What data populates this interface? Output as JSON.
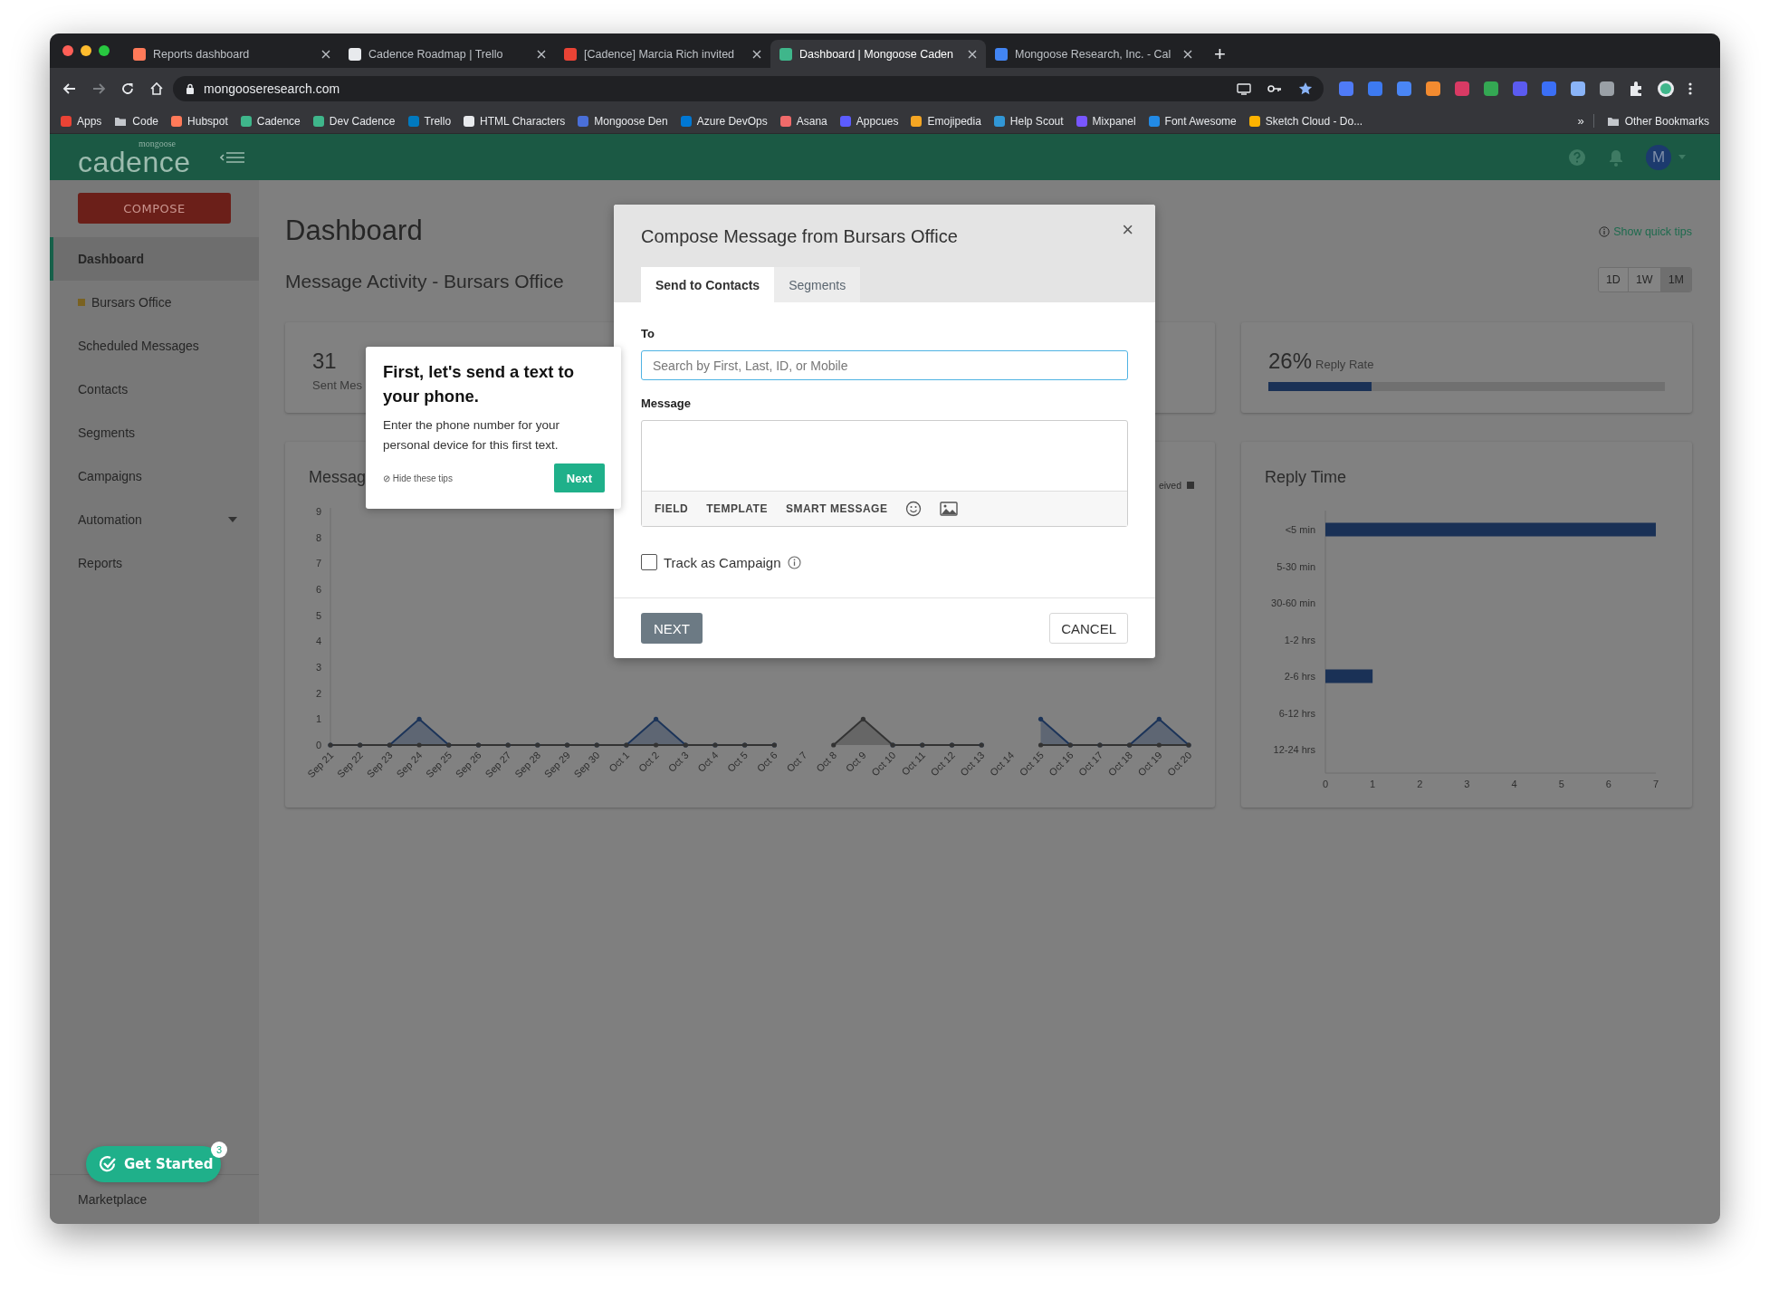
{
  "browser": {
    "tabs": [
      {
        "title": "Reports dashboard",
        "color": "#ff7a59",
        "selected": false
      },
      {
        "title": "Cadence Roadmap | Trello",
        "color": "#e8eaed",
        "selected": false
      },
      {
        "title": "[Cadence] Marcia Rich invited",
        "color": "#ea4335",
        "selected": false
      },
      {
        "title": "Dashboard | Mongoose Caden",
        "color": "#3fb68b",
        "selected": true
      },
      {
        "title": "Mongoose Research, Inc. - Cal",
        "color": "#4285f4",
        "selected": false
      }
    ],
    "new_tab": "+",
    "url": "mongooseresearch.com",
    "bookmarks": [
      {
        "label": "Apps",
        "kind": "site",
        "color": "#ea4335"
      },
      {
        "label": "Code",
        "kind": "folder",
        "color": "#c4c7cc"
      },
      {
        "label": "Hubspot",
        "kind": "site",
        "color": "#ff7a59"
      },
      {
        "label": "Cadence",
        "kind": "site",
        "color": "#3fb68b"
      },
      {
        "label": "Dev Cadence",
        "kind": "site",
        "color": "#3fb68b"
      },
      {
        "label": "Trello",
        "kind": "site",
        "color": "#0079bf"
      },
      {
        "label": "HTML Characters",
        "kind": "site",
        "color": "#e8eaed"
      },
      {
        "label": "Mongoose Den",
        "kind": "site",
        "color": "#4a6fd8"
      },
      {
        "label": "Azure DevOps",
        "kind": "site",
        "color": "#0078d4"
      },
      {
        "label": "Asana",
        "kind": "site",
        "color": "#f06a6a"
      },
      {
        "label": "Appcues",
        "kind": "site",
        "color": "#5c5cff"
      },
      {
        "label": "Emojipedia",
        "kind": "site",
        "color": "#f5a623"
      },
      {
        "label": "Help Scout",
        "kind": "site",
        "color": "#3197d6"
      },
      {
        "label": "Mixpanel",
        "kind": "site",
        "color": "#7856ff"
      },
      {
        "label": "Font Awesome",
        "kind": "site",
        "color": "#228ae6"
      },
      {
        "label": "Sketch Cloud - Do...",
        "kind": "site",
        "color": "#fdb300"
      }
    ],
    "overflow": "»",
    "other_bookmarks": "Other Bookmarks"
  },
  "app": {
    "logo_small": "mongoose",
    "logo": "cadence",
    "avatar": "M"
  },
  "sidebar": {
    "compose": "COMPOSE",
    "items": [
      {
        "label": "Dashboard",
        "kind": "link",
        "selected": true
      },
      {
        "label": "Bursars Office",
        "kind": "inbox",
        "color": "#7a6221",
        "selected": false
      },
      {
        "label": "Scheduled Messages",
        "kind": "link",
        "selected": false
      },
      {
        "label": "Contacts",
        "kind": "link",
        "selected": false
      },
      {
        "label": "Segments",
        "kind": "link",
        "selected": false
      },
      {
        "label": "Campaigns",
        "kind": "link",
        "selected": false
      },
      {
        "label": "Automation",
        "kind": "group",
        "expanded": false,
        "selected": false
      },
      {
        "label": "Reports",
        "kind": "link",
        "selected": false
      }
    ],
    "footer": "Marketplace"
  },
  "get_started": {
    "label": "Get Started",
    "badge": "3"
  },
  "dashboard": {
    "title": "Dashboard",
    "subtitle": "Message Activity - Bursars Office",
    "quick_tips": "Show quick tips",
    "ranges": [
      {
        "label": "1D",
        "selected": false
      },
      {
        "label": "1W",
        "selected": false
      },
      {
        "label": "1M",
        "selected": true
      }
    ],
    "sent": {
      "value": "31",
      "label": "Sent Mes"
    },
    "reply_rate": {
      "value": "26%",
      "label": "Reply Rate",
      "level": 0.26
    },
    "activity_chart": {
      "chart_data": {
        "type": "line",
        "title": "Messag",
        "categories": [
          "Sep 21",
          "Sep 22",
          "Sep 23",
          "Sep 24",
          "Sep 25",
          "Sep 26",
          "Sep 27",
          "Sep 28",
          "Sep 29",
          "Sep 30",
          "Oct 1",
          "Oct 2",
          "Oct 3",
          "Oct 4",
          "Oct 5",
          "Oct 6",
          "Oct 7",
          "Oct 8",
          "Oct 9",
          "Oct 10",
          "Oct 11",
          "Oct 12",
          "Oct 13",
          "Oct 14",
          "Oct 15",
          "Oct 16",
          "Oct 17",
          "Oct 18",
          "Oct 19",
          "Oct 20"
        ],
        "series": [
          {
            "color": "#1c3459",
            "values": [
              0,
              0,
              0,
              1,
              0,
              0,
              0,
              0,
              0,
              0,
              0,
              1,
              0,
              0,
              0,
              0,
              null,
              null,
              null,
              0,
              0,
              0,
              0,
              null,
              1,
              0,
              0,
              0,
              1,
              0
            ]
          },
          {
            "name": "eived",
            "color": "#333333",
            "values": [
              0,
              0,
              0,
              0,
              0,
              0,
              0,
              0,
              0,
              0,
              0,
              0,
              0,
              0,
              0,
              0,
              null,
              0,
              1,
              0,
              0,
              0,
              0,
              null,
              0,
              0,
              0,
              0,
              0,
              0
            ]
          }
        ],
        "ylim": [
          0,
          9
        ],
        "yticks": [
          0,
          1,
          2,
          3,
          4,
          5,
          6,
          7,
          8,
          9
        ]
      }
    },
    "reply_time_chart": {
      "chart_data": {
        "type": "bar",
        "orientation": "horizontal",
        "title": "Reply Time",
        "categories": [
          "<5 min",
          "5-30 min",
          "30-60 min",
          "1-2 hrs",
          "2-6 hrs",
          "6-12 hrs",
          "12-24 hrs"
        ],
        "series": [
          {
            "color": "#1a3156",
            "values": [
              7,
              0,
              0,
              0,
              1,
              0,
              0
            ]
          }
        ],
        "xlim": [
          0,
          7
        ],
        "xticks": [
          0,
          1,
          2,
          3,
          4,
          5,
          6,
          7
        ]
      }
    }
  },
  "tooltip": {
    "title": "First, let's send a text to your phone.",
    "body": "Enter the phone number for your personal device for this first text.",
    "hide_icon": "⊘",
    "hide": "Hide these tips",
    "next": "Next"
  },
  "modal": {
    "title": "Compose Message from Bursars Office",
    "close": "×",
    "tabs": [
      {
        "label": "Send to Contacts",
        "selected": true
      },
      {
        "label": "Segments",
        "selected": false
      }
    ],
    "to": {
      "label": "To",
      "placeholder": "Search by First, Last, ID, or Mobile"
    },
    "message": {
      "label": "Message",
      "tools": [
        "FIELD",
        "TEMPLATE",
        "SMART MESSAGE"
      ]
    },
    "track": {
      "label": "Track as Campaign",
      "checked": false
    },
    "next": "NEXT",
    "cancel": "CANCEL"
  }
}
